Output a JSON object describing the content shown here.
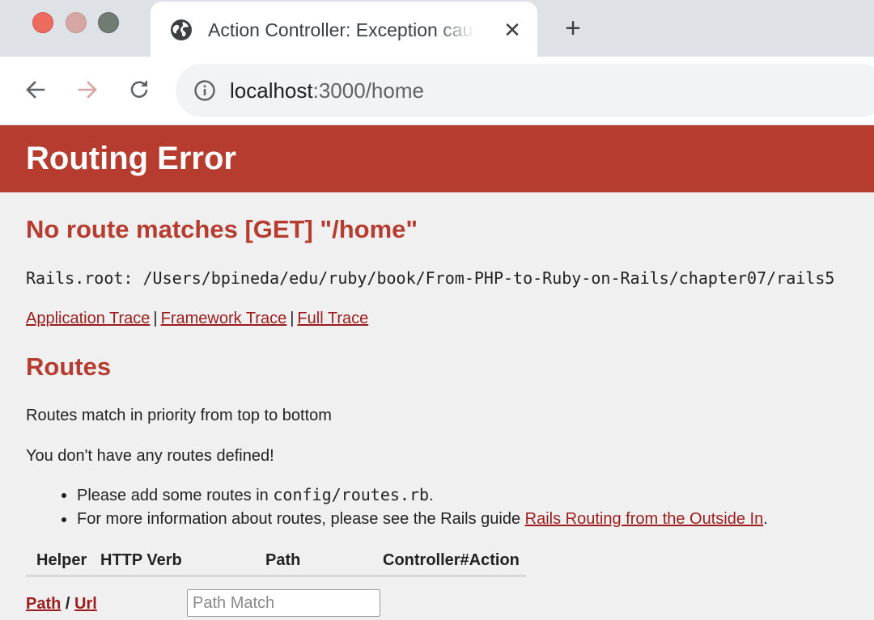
{
  "browser": {
    "tab_title": "Action Controller: Exception caught",
    "close_tab_glyph": "✕",
    "new_tab_glyph": "+",
    "url_host": "localhost",
    "url_rest": ":3000/home",
    "icons": {
      "window_close": "traffic-light-close",
      "window_minimize": "traffic-light-minimize",
      "window_zoom": "traffic-light-zoom",
      "favicon": "globe-icon",
      "back": "arrow-left-icon",
      "forward": "arrow-right-icon",
      "reload": "reload-icon",
      "site_info": "info-icon"
    }
  },
  "page": {
    "header_title": "Routing Error",
    "error_message": "No route matches [GET] \"/home\"",
    "rails_root": "Rails.root: /Users/bpineda/edu/ruby/book/From-PHP-to-Ruby-on-Rails/chapter07/rails5",
    "traces": {
      "application": "Application Trace",
      "framework": "Framework Trace",
      "full": "Full Trace",
      "separator": "|"
    },
    "routes": {
      "heading": "Routes",
      "priority_note": "Routes match in priority from top to bottom",
      "none_defined": "You don't have any routes defined!",
      "bullet1_prefix": "Please add some routes in ",
      "bullet1_code": "config/routes.rb",
      "bullet1_suffix": ".",
      "bullet2_prefix": "For more information about routes, please see the Rails guide ",
      "bullet2_link": "Rails Routing from the Outside In",
      "bullet2_suffix": ".",
      "table_headers": [
        "Helper",
        "HTTP Verb",
        "Path",
        "Controller#Action"
      ],
      "path_link": "Path",
      "slash": " / ",
      "url_link": "Url",
      "search_placeholder": "Path Match"
    }
  },
  "colors": {
    "header_bg": "#b53c2e",
    "heading_red": "#b53c2e",
    "link_red": "#9b1c1c",
    "page_bg": "#f0f0f0"
  }
}
